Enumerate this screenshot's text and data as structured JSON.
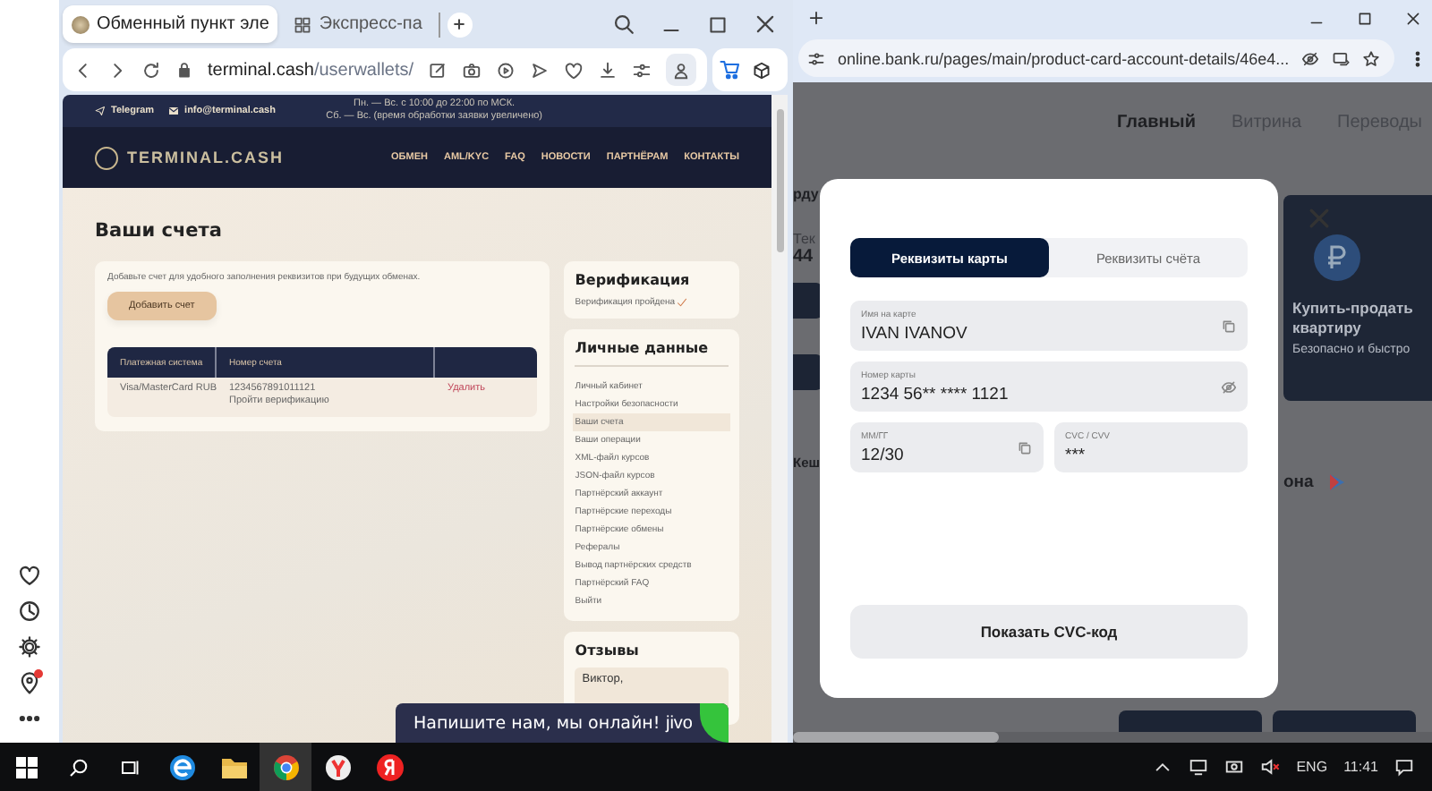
{
  "left_browser": {
    "tabs": [
      {
        "title": "Обменный пункт эле",
        "selected": true
      },
      {
        "title": "Экспресс-па",
        "selected": false
      }
    ],
    "address": {
      "host": "terminal.cash",
      "path": "/userwallets/"
    },
    "site": {
      "contacts": [
        "Telegram",
        "info@terminal.cash"
      ],
      "hours": [
        "Пн. — Вс. с 10:00 до 22:00 по МСК.",
        "Сб. — Вс. (время обработки заявки увеличено)"
      ],
      "logo": "TERMINAL.CASH",
      "menu": [
        "ОБМЕН",
        "AML/KYC",
        "FAQ",
        "НОВОСТИ",
        "ПАРТНЁРАМ",
        "КОНТАКТЫ"
      ],
      "title": "Ваши счета",
      "hint": "Добавьте счет для удобного заполнения реквизитов при будущих обменах.",
      "add_button": "Добавить счет",
      "table": {
        "columns": [
          "Платежная система",
          "Номер счета"
        ],
        "rows": [
          {
            "system": "Visa/MasterCard RUB",
            "account": "1234567891011121",
            "note": "Пройти верификацию",
            "action": "Удалить"
          }
        ]
      },
      "verification": {
        "title": "Верификация",
        "status": "Верификация пройдена",
        "verified": true
      },
      "personal": {
        "title": "Личные данные",
        "items": [
          {
            "label": "Личный кабинет",
            "selected": false
          },
          {
            "label": "Настройки безопасности",
            "selected": false
          },
          {
            "label": "Ваши счета",
            "selected": true
          },
          {
            "label": "Ваши операции",
            "selected": false
          },
          {
            "label": "XML-файл курсов",
            "selected": false
          },
          {
            "label": "JSON-файл курсов",
            "selected": false
          },
          {
            "label": "Партнёрский аккаунт",
            "selected": false
          },
          {
            "label": "Партнёрские переходы",
            "selected": false
          },
          {
            "label": "Партнёрские обмены",
            "selected": false
          },
          {
            "label": "Рефералы",
            "selected": false
          },
          {
            "label": "Вывод партнёрских средств",
            "selected": false
          },
          {
            "label": "Партнёрский FAQ",
            "selected": false
          },
          {
            "label": "Выйти",
            "selected": false
          }
        ]
      },
      "reviews": {
        "title": "Отзывы",
        "author": "Виктор,"
      }
    },
    "chat": {
      "text": "Напишите нам, мы онлайн!",
      "brand": "jivo"
    }
  },
  "right_browser": {
    "address": "online.bank.ru/pages/main/product-card-account-details/46e4...",
    "nav": [
      {
        "label": "Главный",
        "selected": true
      },
      {
        "label": "Витрина",
        "selected": false
      },
      {
        "label": "Переводы",
        "selected": false
      }
    ],
    "heading_fragment": "рду",
    "balance_label_fragment": "Тек",
    "balance_fragment": "44",
    "cashback_fragment": "Кеш",
    "promo": {
      "title": "Купить-продать квартиру",
      "subtitle": "Безопасно и быстро"
    },
    "offer_fragment": "она",
    "modal": {
      "tabs": [
        {
          "label": "Реквизиты карты",
          "selected": true
        },
        {
          "label": "Реквизиты счёта",
          "selected": false
        }
      ],
      "fields": [
        {
          "label": "Имя на карте",
          "value": "IVAN IVANOV",
          "kind": "copy",
          "wide": true
        },
        {
          "label": "Номер карты",
          "value": "1234 56** **** 1121",
          "kind": "hide",
          "wide": true
        },
        {
          "label": "ММ/ГГ",
          "value": "12/30",
          "kind": "copy",
          "wide": false
        },
        {
          "label": "CVC / CVV",
          "value": "***",
          "kind": "plain",
          "wide": false
        }
      ],
      "button": "Показать CVC-код"
    }
  },
  "taskbar": {
    "language": "ENG",
    "time": "11:41"
  }
}
